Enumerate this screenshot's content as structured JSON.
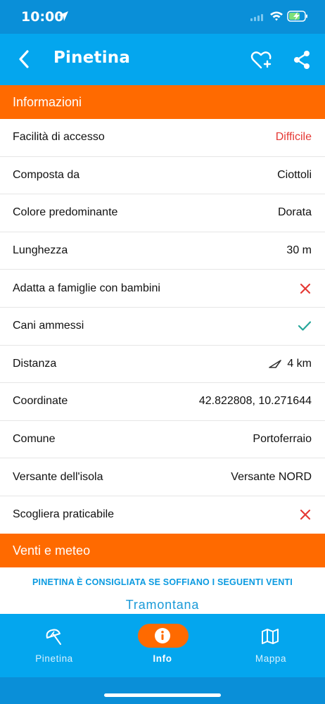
{
  "status_bar": {
    "time": "10:00"
  },
  "nav": {
    "title": "Pinetina"
  },
  "sections": {
    "info_title": "Informazioni",
    "weather_title": "Venti e meteo"
  },
  "info_rows": [
    {
      "label": "Facilità di accesso",
      "value": "Difficile"
    },
    {
      "label": "Composta da",
      "value": "Ciottoli"
    },
    {
      "label": "Colore predominante",
      "value": "Dorata"
    },
    {
      "label": "Lunghezza",
      "value": "30 m"
    },
    {
      "label": "Adatta a famiglie con bambini",
      "value_icon": "cross-icon"
    },
    {
      "label": "Cani ammessi",
      "value_icon": "check-icon"
    },
    {
      "label": "Distanza",
      "value": "4 km",
      "value_icon": "distance-arrow-icon"
    },
    {
      "label": "Coordinate",
      "value": "42.822808, 10.271644"
    },
    {
      "label": "Comune",
      "value": "Portoferraio"
    },
    {
      "label": "Versante dell'isola",
      "value": "Versante NORD"
    },
    {
      "label": "Scogliera praticabile",
      "value_icon": "cross-icon"
    }
  ],
  "weather": {
    "advice": "PINETINA È CONSIGLIATA SE SOFFIANO I SEGUENTI VENTI",
    "wind": "Tramontana"
  },
  "tabs": [
    {
      "label": "Pinetina",
      "icon": "beach-umbrella-icon",
      "active": false
    },
    {
      "label": "Info",
      "icon": "info-icon",
      "active": true
    },
    {
      "label": "Mappa",
      "icon": "map-icon",
      "active": false
    }
  ],
  "colors": {
    "header_blue": "#04a6ee",
    "status_blue": "#0a8fd8",
    "accent_orange": "#ff6a00",
    "negative_red": "#e53935",
    "positive_green": "#26a69a"
  }
}
